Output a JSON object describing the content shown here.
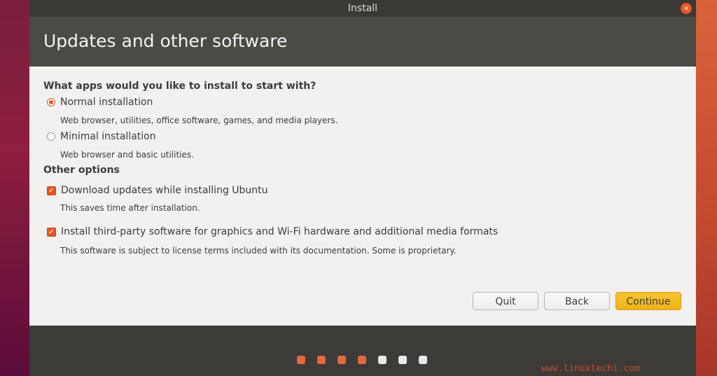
{
  "window": {
    "title": "Install",
    "close_glyph": "×"
  },
  "header": {
    "title": "Updates and other software"
  },
  "apps_section": {
    "heading": "What apps would you like to install to start with?",
    "normal": {
      "label": "Normal installation",
      "description": "Web browser, utilities, office software, games, and media players.",
      "selected": true
    },
    "minimal": {
      "label": "Minimal installation",
      "description": "Web browser and basic utilities.",
      "selected": false
    }
  },
  "other_section": {
    "heading": "Other options",
    "download_updates": {
      "label": "Download updates while installing Ubuntu",
      "description": "This saves time after installation.",
      "checked": true
    },
    "third_party": {
      "label": "Install third-party software for graphics and Wi-Fi hardware and additional media formats",
      "description": "This software is subject to license terms included with its documentation. Some is proprietary.",
      "checked": true
    }
  },
  "buttons": {
    "quit": "Quit",
    "back": "Back",
    "continue": "Continue"
  },
  "progress": {
    "steps_total": 7,
    "steps_completed": 4,
    "completed_color": "#e2693c",
    "pending_color": "#e8e8e8"
  },
  "colors": {
    "accent": "#e95420",
    "primary_button": "#efb318"
  },
  "watermark": "www.linuxtechi.com"
}
